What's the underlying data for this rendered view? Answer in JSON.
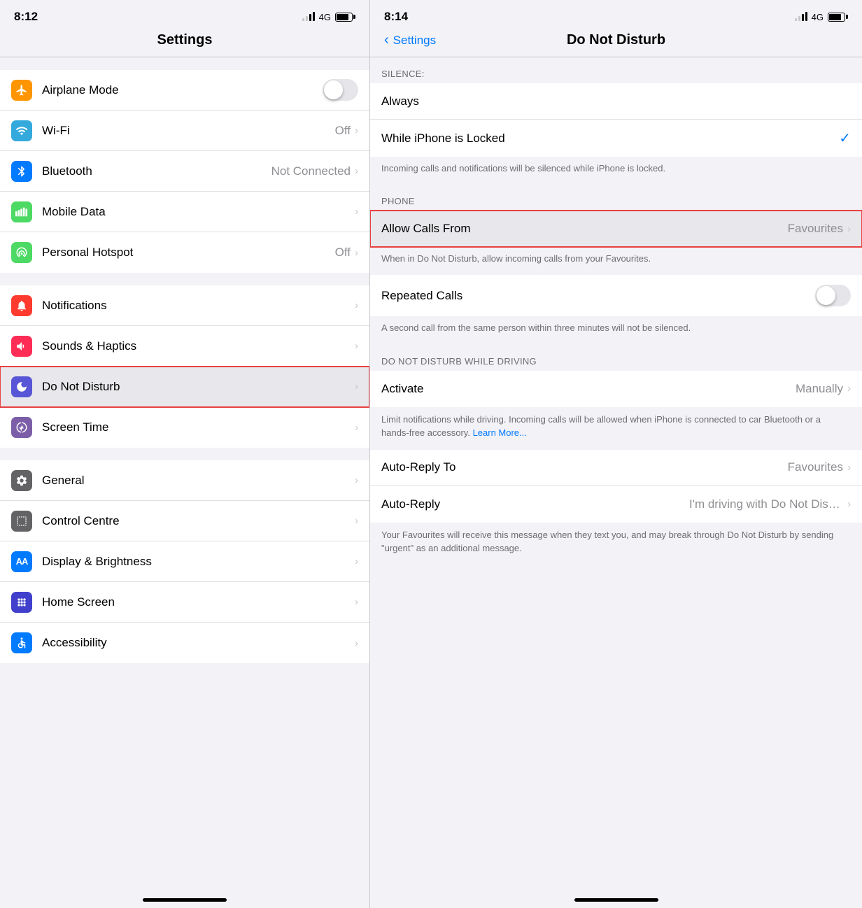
{
  "left": {
    "status": {
      "time": "8:12",
      "network": "4G"
    },
    "header": {
      "title": "Settings"
    },
    "groups": [
      {
        "id": "connectivity",
        "items": [
          {
            "id": "airplane-mode",
            "icon": "✈",
            "iconColor": "icon-orange",
            "label": "Airplane Mode",
            "value": "",
            "hasToggle": true,
            "toggleOn": false,
            "hasChevron": false
          },
          {
            "id": "wifi",
            "icon": "wifi",
            "iconColor": "icon-blue-bright",
            "label": "Wi-Fi",
            "value": "Off",
            "hasToggle": false,
            "hasChevron": true
          },
          {
            "id": "bluetooth",
            "icon": "bt",
            "iconColor": "icon-blue",
            "label": "Bluetooth",
            "value": "Not Connected",
            "hasToggle": false,
            "hasChevron": true
          },
          {
            "id": "mobile-data",
            "icon": "signal",
            "iconColor": "icon-green",
            "label": "Mobile Data",
            "value": "",
            "hasToggle": false,
            "hasChevron": true
          },
          {
            "id": "personal-hotspot",
            "icon": "hotspot",
            "iconColor": "icon-green",
            "label": "Personal Hotspot",
            "value": "Off",
            "hasToggle": false,
            "hasChevron": true
          }
        ]
      },
      {
        "id": "notifications",
        "items": [
          {
            "id": "notifications",
            "icon": "🔔",
            "iconColor": "icon-red",
            "label": "Notifications",
            "value": "",
            "hasToggle": false,
            "hasChevron": true
          },
          {
            "id": "sounds-haptics",
            "icon": "🔊",
            "iconColor": "icon-pink",
            "label": "Sounds & Haptics",
            "value": "",
            "hasToggle": false,
            "hasChevron": true
          },
          {
            "id": "do-not-disturb",
            "icon": "🌙",
            "iconColor": "icon-purple",
            "label": "Do Not Disturb",
            "value": "",
            "hasToggle": false,
            "hasChevron": true,
            "highlighted": true
          },
          {
            "id": "screen-time",
            "icon": "⏳",
            "iconColor": "icon-purple-screen",
            "label": "Screen Time",
            "value": "",
            "hasToggle": false,
            "hasChevron": true
          }
        ]
      },
      {
        "id": "system",
        "items": [
          {
            "id": "general",
            "icon": "⚙",
            "iconColor": "icon-gray-dark",
            "label": "General",
            "value": "",
            "hasToggle": false,
            "hasChevron": true
          },
          {
            "id": "control-centre",
            "icon": "ctrl",
            "iconColor": "icon-gray-dark",
            "label": "Control Centre",
            "value": "",
            "hasToggle": false,
            "hasChevron": true
          },
          {
            "id": "display-brightness",
            "icon": "AA",
            "iconColor": "icon-blue",
            "label": "Display & Brightness",
            "value": "",
            "hasToggle": false,
            "hasChevron": true
          },
          {
            "id": "home-screen",
            "icon": "grid",
            "iconColor": "icon-indigo",
            "label": "Home Screen",
            "value": "",
            "hasToggle": false,
            "hasChevron": true
          },
          {
            "id": "accessibility",
            "icon": "♿",
            "iconColor": "icon-blue",
            "label": "Accessibility",
            "value": "",
            "hasToggle": false,
            "hasChevron": true
          }
        ]
      }
    ]
  },
  "right": {
    "status": {
      "time": "8:14",
      "network": "4G"
    },
    "nav": {
      "backLabel": "Settings",
      "title": "Do Not Disturb"
    },
    "sections": [
      {
        "id": "silence",
        "header": "SILENCE:",
        "items": [
          {
            "id": "always",
            "label": "Always",
            "value": "",
            "hasCheck": false,
            "hasChevron": false,
            "hasToggle": false
          },
          {
            "id": "while-locked",
            "label": "While iPhone is Locked",
            "value": "",
            "hasCheck": true,
            "hasChevron": false,
            "hasToggle": false
          }
        ],
        "description": "Incoming calls and notifications will be silenced while iPhone is locked."
      },
      {
        "id": "phone",
        "header": "PHONE",
        "items": [
          {
            "id": "allow-calls-from",
            "label": "Allow Calls From",
            "value": "Favourites",
            "hasCheck": false,
            "hasChevron": true,
            "hasToggle": false,
            "highlighted": true
          }
        ],
        "description": "When in Do Not Disturb, allow incoming calls from your Favourites.",
        "items2": [
          {
            "id": "repeated-calls",
            "label": "Repeated Calls",
            "value": "",
            "hasCheck": false,
            "hasChevron": false,
            "hasToggle": true,
            "toggleOn": false
          }
        ],
        "description2": "A second call from the same person within three minutes will not be silenced."
      },
      {
        "id": "driving",
        "header": "DO NOT DISTURB WHILE DRIVING",
        "items": [
          {
            "id": "activate",
            "label": "Activate",
            "value": "Manually",
            "hasCheck": false,
            "hasChevron": true,
            "hasToggle": false
          }
        ],
        "description": "Limit notifications while driving. Incoming calls will be allowed when iPhone is connected to car Bluetooth or a hands-free accessory.",
        "learnMore": "Learn More...",
        "items2": [
          {
            "id": "auto-reply-to",
            "label": "Auto-Reply To",
            "value": "Favourites",
            "hasCheck": false,
            "hasChevron": true,
            "hasToggle": false
          },
          {
            "id": "auto-reply",
            "label": "Auto-Reply",
            "value": "I'm driving with Do Not Distu...",
            "hasCheck": false,
            "hasChevron": true,
            "hasToggle": false
          }
        ],
        "description2": "Your Favourites will receive this message when they text you, and may break through Do Not Disturb by sending \"urgent\" as an additional message."
      }
    ]
  }
}
